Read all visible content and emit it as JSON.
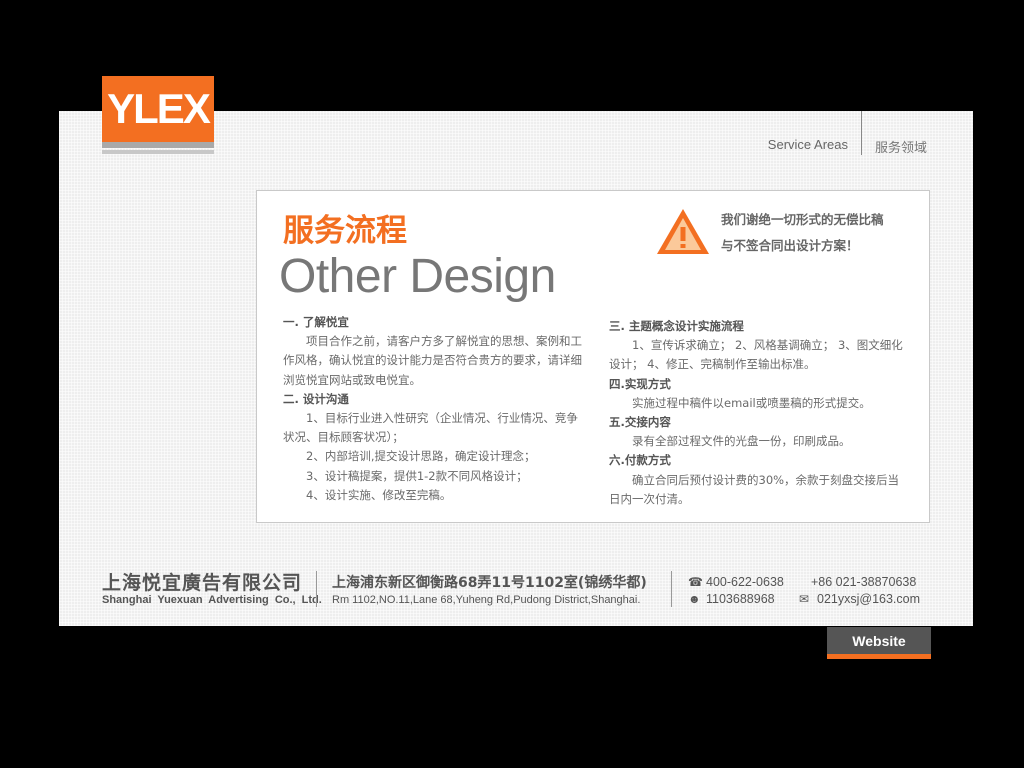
{
  "logo": {
    "text": "YLEX"
  },
  "nav": {
    "service_en": "Service Areas",
    "service_zh": "服务领域"
  },
  "card": {
    "title_zh": "服务流程",
    "title_en": "Other Design",
    "warning": {
      "icon": "warning-triangle-icon",
      "line1": "我们谢绝一切形式的无偿比稿",
      "line2": "与不签合同出设计方案！"
    },
    "left": [
      {
        "type": "h",
        "text": "一. 了解悦宜"
      },
      {
        "type": "p",
        "text": "项目合作之前，请客户方多了解悦宜的思想、案例和工作风格，确认悦宜的设计能力是否符合贵方的要求，请详细浏览悦宜网站或致电悦宜。"
      },
      {
        "type": "h",
        "text": "二. 设计沟通"
      },
      {
        "type": "p",
        "text": "1、目标行业进入性研究（企业情况、行业情况、竞争状况、目标顾客状况）；"
      },
      {
        "type": "p",
        "text": "2、内部培训,提交设计思路，确定设计理念；"
      },
      {
        "type": "p",
        "text": "3、设计稿提案，提供1-2款不同风格设计；"
      },
      {
        "type": "p",
        "text": "4、设计实施、修改至完稿。"
      }
    ],
    "right": [
      {
        "type": "h",
        "text": "三. 主题概念设计实施流程"
      },
      {
        "type": "p",
        "text": "1、宣传诉求确立； 2、风格基调确立； 3、图文细化设计； 4、修正、完稿制作至输出标准。"
      },
      {
        "type": "h",
        "text": "四.实现方式"
      },
      {
        "type": "p",
        "text": "实施过程中稿件以email或喷墨稿的形式提交。"
      },
      {
        "type": "h",
        "text": "五.交接内容"
      },
      {
        "type": "p",
        "text": "录有全部过程文件的光盘一份，印刷成品。"
      },
      {
        "type": "h",
        "text": "六.付款方式"
      },
      {
        "type": "p",
        "text": "确立合同后预付设计费的30%，余款于刻盘交接后当日内一次付清。"
      }
    ]
  },
  "footer": {
    "company_zh": "上海悦宜廣告有限公司",
    "company_en": "Shanghai Yuexuan Advertising Co., Ltd.",
    "address_zh": "上海浦东新区御衡路68弄11号1102室(锦绣华都)",
    "address_en": "Rm 1102,NO.11,Lane 68,Yuheng Rd,Pudong District,Shanghai.",
    "phone": "400-622-0638",
    "tel": "+86 021-38870638",
    "qq": "1103688968",
    "email": "021yxsj@163.com"
  },
  "website_button": "Website",
  "colors": {
    "accent": "#f36f21",
    "background": "#000000",
    "panel": "#eeeeee"
  }
}
